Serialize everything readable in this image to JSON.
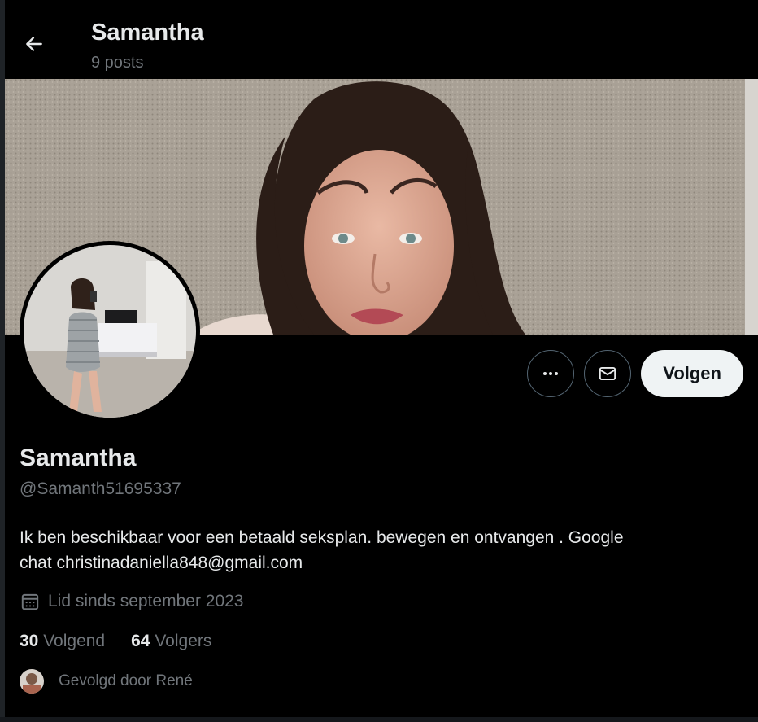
{
  "header": {
    "title": "Samantha",
    "post_count": "9 posts"
  },
  "actions": {
    "more_icon": "more-horizontal-icon",
    "message_icon": "envelope-icon",
    "follow_label": "Volgen"
  },
  "profile": {
    "display_name": "Samantha",
    "handle": "@Samanth51695337",
    "bio_line1": "Ik ben beschikbaar voor een betaald seksplan. bewegen en ontvangen . Google",
    "bio_line2": "chat christinadaniella848@gmail.com",
    "joined": "Lid sinds september 2023",
    "following_count": "30",
    "following_label": "Volgend",
    "followers_count": "64",
    "followers_label": "Volgers",
    "followed_by": "Gevolgd door René"
  },
  "colors": {
    "background": "#000000",
    "text_primary": "#e7e9ea",
    "text_secondary": "#71767b",
    "button_light": "#eff3f4",
    "border": "#536471"
  }
}
